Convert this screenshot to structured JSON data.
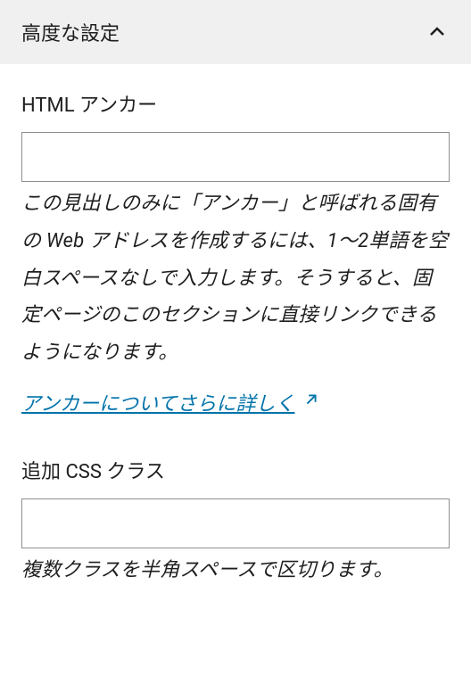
{
  "panel": {
    "title": "高度な設定"
  },
  "fields": {
    "anchor": {
      "label": "HTML アンカー",
      "value": "",
      "help": "この見出しのみに「アンカー」と呼ばれる固有の Web アドレスを作成するには、1〜2単語を空白スペースなしで入力します。そうすると、固定ページのこのセクションに直接リンクできるようになります。",
      "link_text": "アンカーについてさらに詳しく"
    },
    "css_class": {
      "label": "追加 CSS クラス",
      "value": "",
      "help": "複数クラスを半角スペースで区切ります。"
    }
  }
}
